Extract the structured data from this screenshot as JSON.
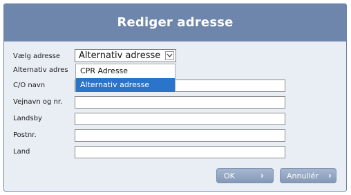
{
  "dialog": {
    "title": "Rediger adresse"
  },
  "form": {
    "address_select": {
      "label": "Vælg adresse",
      "value": "Alternativ adresse"
    },
    "dropdown_options": [
      {
        "label": "CPR Adresse",
        "selected": false
      },
      {
        "label": "Alternativ adresse",
        "selected": true
      }
    ],
    "alt_address_label": "Alternativ adres",
    "fields": [
      {
        "label": "C/O navn",
        "value": ""
      },
      {
        "label": "Vejnavn og nr.",
        "value": ""
      },
      {
        "label": "Landsby",
        "value": ""
      },
      {
        "label": "Postnr.",
        "value": ""
      },
      {
        "label": "Land",
        "value": ""
      }
    ]
  },
  "buttons": {
    "ok": {
      "label": "OK",
      "icon": "chevron-right-icon"
    },
    "cancel": {
      "label": "Annullér",
      "icon": "chevron-right-icon"
    }
  },
  "colors": {
    "titlebar": "#6e86ab",
    "dialog_bg": "#e9eef5",
    "selected_option": "#2a74c9"
  }
}
